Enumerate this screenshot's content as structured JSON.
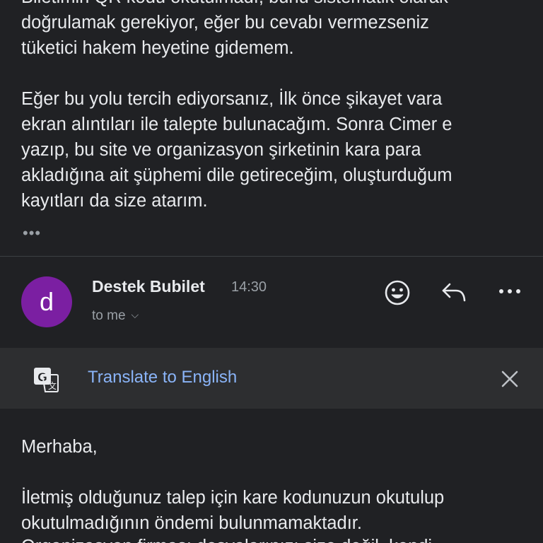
{
  "previous_message": {
    "cut_line": "Biletimin QR kodu okutulmadı, bunu sistematik olarak",
    "lines_para1": [
      "doğrulamak gerekiyor, eğer bu cevabı vermezseniz",
      "tüketici hakem heyetine gidemem."
    ],
    "lines_para2": [
      "Eğer bu yolu tercih ediyorsanız, İlk önce şikayet vara",
      "ekran alıntıları ile talepte bulunacağım. Sonra Cimer e",
      "yazıp, bu site ve organizasyon şirketinin kara para",
      "akladığına ait şüphemi dile getireceğim, oluşturduğum",
      "kayıtları da size atarım."
    ],
    "more_label": "•••"
  },
  "message": {
    "avatar_letter": "d",
    "avatar_color": "#7b1fa2",
    "sender": "Destek Bubilet",
    "time": "14:30",
    "recipient": "to me",
    "actions": [
      "smiley-icon",
      "reply-icon",
      "more-options-icon"
    ]
  },
  "translate": {
    "label": "Translate to English",
    "icon": "google-translate-icon",
    "close_icon": "close-icon"
  },
  "body": {
    "greeting": "Merhaba,",
    "lines": [
      "İletmiş olduğunuz talep için kare kodunuzun okutulup",
      "okutulmadığının öndemi bulunmamaktadır."
    ],
    "partial_line": "Organizasyon firması dosyalarınızı size değil, kendi"
  },
  "colors": {
    "background": "#202124",
    "translate_bar": "#2d2e30",
    "link": "#8ab4f8",
    "muted": "#9aa0a6"
  }
}
